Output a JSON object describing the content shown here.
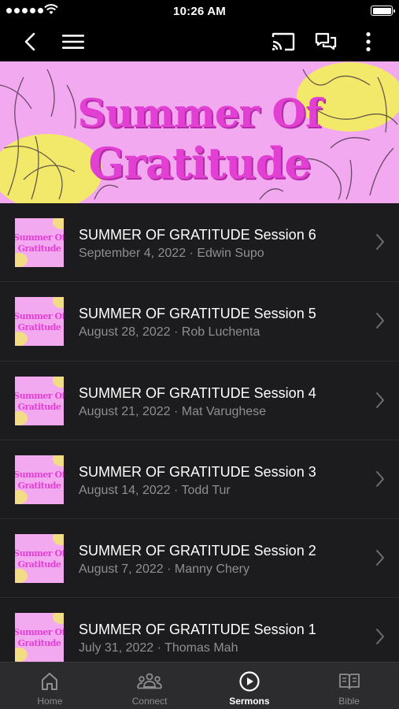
{
  "status_bar": {
    "time": "10:26 AM"
  },
  "nav": {
    "back_icon": "back-arrow-icon",
    "menu_icon": "hamburger-menu-icon",
    "cast_icon": "cast-icon",
    "chat_icon": "chat-icon",
    "more_icon": "more-vertical-icon"
  },
  "banner": {
    "line1": "Summer Of",
    "line2": "Gratitude"
  },
  "thumbnail": {
    "line1": "Summer Of",
    "line2": "Gratitude"
  },
  "sermons": [
    {
      "title": "SUMMER OF GRATITUDE Session 6",
      "subtitle": "September 4, 2022 · Edwin Supo"
    },
    {
      "title": "SUMMER OF GRATITUDE Session 5",
      "subtitle": "August 28, 2022 · Rob Luchenta"
    },
    {
      "title": "SUMMER OF GRATITUDE Session 4",
      "subtitle": "August 21, 2022 · Mat Varughese"
    },
    {
      "title": "SUMMER OF GRATITUDE Session 3",
      "subtitle": "August 14, 2022 · Todd Tur"
    },
    {
      "title": "SUMMER OF GRATITUDE Session 2",
      "subtitle": "August 7, 2022 · Manny Chery"
    },
    {
      "title": "SUMMER OF GRATITUDE Session 1",
      "subtitle": "July 31, 2022 · Thomas Mah"
    }
  ],
  "tabs": [
    {
      "label": "Home",
      "icon": "home-icon",
      "active": false
    },
    {
      "label": "Connect",
      "icon": "people-icon",
      "active": false
    },
    {
      "label": "Sermons",
      "icon": "play-circle-icon",
      "active": true
    },
    {
      "label": "Bible",
      "icon": "book-icon",
      "active": false
    }
  ],
  "colors": {
    "banner_pink": "#f3a9f0",
    "title_magenta": "#e23fd3",
    "list_bg": "#1c1c1e",
    "tab_bg": "#2c2c2e",
    "secondary_text": "#8e8e93"
  }
}
